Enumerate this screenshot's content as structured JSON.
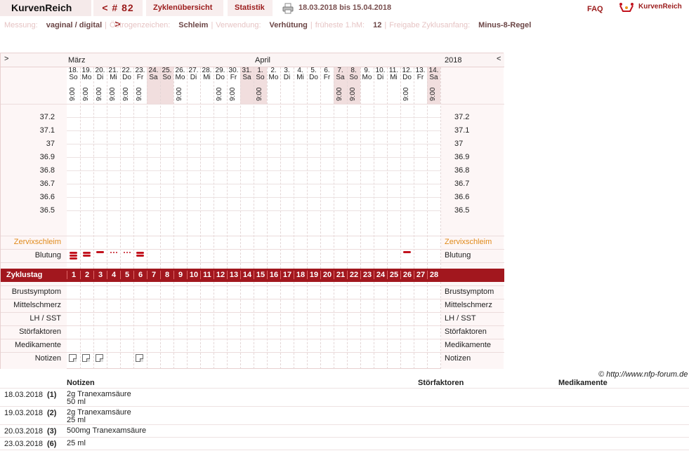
{
  "header": {
    "brand": "KurvenReich",
    "cycle": "< # 82 >",
    "tab_overview": "Zyklenübersicht",
    "tab_stats": "Statistik",
    "date_range": "18.03.2018 bis 15.04.2018",
    "faq": "FAQ",
    "logo_text": "KurvenReich"
  },
  "info": {
    "messung_label": "Messung:",
    "messung_value": "vaginal / digital",
    "oestrogen_label": "Östrogenzeichen:",
    "oestrogen_value": "Schleim",
    "verwendung_label": "Verwendung:",
    "verwendung_value": "Verhütung",
    "hm_label": "früheste 1.hM:",
    "hm_value": "12",
    "freigabe_label": "Freigabe Zyklusanfang:",
    "freigabe_value": "Minus-8-Regel"
  },
  "chart": {
    "nav_left": ">",
    "nav_right": "<",
    "month1": "März",
    "month2": "April",
    "year": "2018",
    "days": [
      {
        "d": "18.",
        "w": "So",
        "t": "9:00",
        "we": false
      },
      {
        "d": "19.",
        "w": "Mo",
        "t": "9:00",
        "we": false
      },
      {
        "d": "20.",
        "w": "Di",
        "t": "9:00",
        "we": false
      },
      {
        "d": "21.",
        "w": "Mi",
        "t": "9:00",
        "we": false
      },
      {
        "d": "22.",
        "w": "Do",
        "t": "9:00",
        "we": false
      },
      {
        "d": "23.",
        "w": "Fr",
        "t": "9:00",
        "we": false
      },
      {
        "d": "24.",
        "w": "Sa",
        "t": "",
        "we": true
      },
      {
        "d": "25.",
        "w": "So",
        "t": "",
        "we": true
      },
      {
        "d": "26.",
        "w": "Mo",
        "t": "9:00",
        "we": false
      },
      {
        "d": "27.",
        "w": "Di",
        "t": "",
        "we": false
      },
      {
        "d": "28.",
        "w": "Mi",
        "t": "",
        "we": false
      },
      {
        "d": "29.",
        "w": "Do",
        "t": "9:00",
        "we": false
      },
      {
        "d": "30.",
        "w": "Fr",
        "t": "9:00",
        "we": false
      },
      {
        "d": "31.",
        "w": "Sa",
        "t": "",
        "we": true
      },
      {
        "d": "1.",
        "w": "So",
        "t": "9:00",
        "we": true
      },
      {
        "d": "2.",
        "w": "Mo",
        "t": "",
        "we": false
      },
      {
        "d": "3.",
        "w": "Di",
        "t": "",
        "we": false
      },
      {
        "d": "4.",
        "w": "Mi",
        "t": "",
        "we": false
      },
      {
        "d": "5.",
        "w": "Do",
        "t": "",
        "we": false
      },
      {
        "d": "6.",
        "w": "Fr",
        "t": "",
        "we": false
      },
      {
        "d": "7.",
        "w": "Sa",
        "t": "9:00",
        "we": true
      },
      {
        "d": "8.",
        "w": "So",
        "t": "9:00",
        "we": true
      },
      {
        "d": "9.",
        "w": "Mo",
        "t": "",
        "we": false
      },
      {
        "d": "10.",
        "w": "Di",
        "t": "",
        "we": false
      },
      {
        "d": "11.",
        "w": "Mi",
        "t": "",
        "we": false
      },
      {
        "d": "12.",
        "w": "Do",
        "t": "9:00",
        "we": false
      },
      {
        "d": "13.",
        "w": "Fr",
        "t": "",
        "we": false
      },
      {
        "d": "14.",
        "w": "Sa",
        "t": "9:00",
        "we": true
      }
    ],
    "temps": [
      "37.2",
      "37.1",
      "37",
      "36.9",
      "36.8",
      "36.7",
      "36.6",
      "36.5"
    ],
    "zervix_label": "Zervixschleim",
    "blutung_label": "Blutung",
    "zyklustag_label": "Zyklustag",
    "bleeding": [
      {
        "day": 1,
        "type": "heavy"
      },
      {
        "day": 2,
        "type": "medium"
      },
      {
        "day": 3,
        "type": "light"
      },
      {
        "day": 4,
        "type": "spotting"
      },
      {
        "day": 5,
        "type": "spotting"
      },
      {
        "day": 6,
        "type": "medium"
      },
      {
        "day": 26,
        "type": "light"
      }
    ],
    "rows": [
      "Brustsymptom",
      "Mittelschmerz",
      "LH / SST",
      "Störfaktoren",
      "Medikamente",
      "Notizen"
    ],
    "note_days": [
      1,
      2,
      3,
      6
    ]
  },
  "copyright": "© http://www.nfp-forum.de",
  "notes_table": {
    "headers": {
      "notizen": "Notizen",
      "stoer": "Störfaktoren",
      "medi": "Medikamente"
    },
    "entries": [
      {
        "date": "18.03.2018",
        "num": "(1)",
        "line1": "2g Tranexamsäure",
        "line2": "50 ml"
      },
      {
        "date": "19.03.2018",
        "num": "(2)",
        "line1": "2g Tranexamsäure",
        "line2": "25 ml"
      },
      {
        "date": "20.03.2018",
        "num": "(3)",
        "line1": "500mg Tranexamsäure",
        "line2": ""
      },
      {
        "date": "23.03.2018",
        "num": "(6)",
        "line1": "25 ml",
        "line2": ""
      }
    ]
  }
}
